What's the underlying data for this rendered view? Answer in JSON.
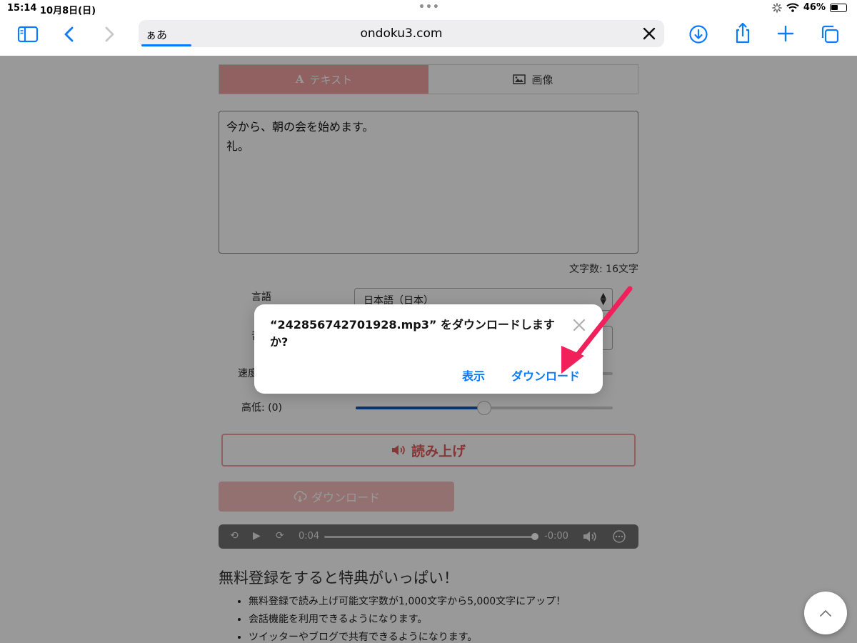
{
  "status_bar": {
    "time": "15:14",
    "date": "10月8日(日)",
    "battery_percent": "46%",
    "battery_level": 0.46,
    "dots": "•••"
  },
  "toolbar": {
    "aa_label": "ぁあ",
    "domain": "ondoku3.com",
    "icons": [
      "sidebar-icon",
      "back-icon",
      "forward-icon",
      "clear-icon",
      "downloads-icon",
      "share-icon",
      "new-tab-icon",
      "tabs-icon"
    ]
  },
  "page": {
    "tabs": [
      {
        "label": "テキスト",
        "icon": "text-icon"
      },
      {
        "label": "画像",
        "icon": "image-icon"
      }
    ],
    "text_value": "今から、朝の会を始めます。\n礼。",
    "char_count": "文字数: 16文字",
    "language_label": "言語",
    "language_value": "日本語（日本）",
    "voice_label_partial": "音",
    "speed_label_partial": "速度",
    "pitch_label": "高低: (0)",
    "pitch_level": 0.5,
    "read_button": "読み上げ",
    "download_button": "ダウンロード",
    "audio": {
      "current": "0:04",
      "remaining": "-0:00",
      "progress": 0.99
    },
    "promo_title": "無料登録をすると特典がいっぱい！",
    "promo_items": [
      "無料登録で読み上げ可能文字数が1,000文字から5,000文字にアップ！",
      "会話機能を利用できるようになります。",
      "ツイッターやブログで共有できるようになります。"
    ]
  },
  "dialog": {
    "message": "“242856742701928.mp3” をダウンロードしますか?",
    "show_button": "表示",
    "download_button": "ダウンロード",
    "close_icon": "close-icon"
  },
  "annotation": {
    "arrow_color": "#f0205a"
  },
  "colors": {
    "accent": "#0a7aff",
    "brand_pink": "#f2a0a0"
  }
}
